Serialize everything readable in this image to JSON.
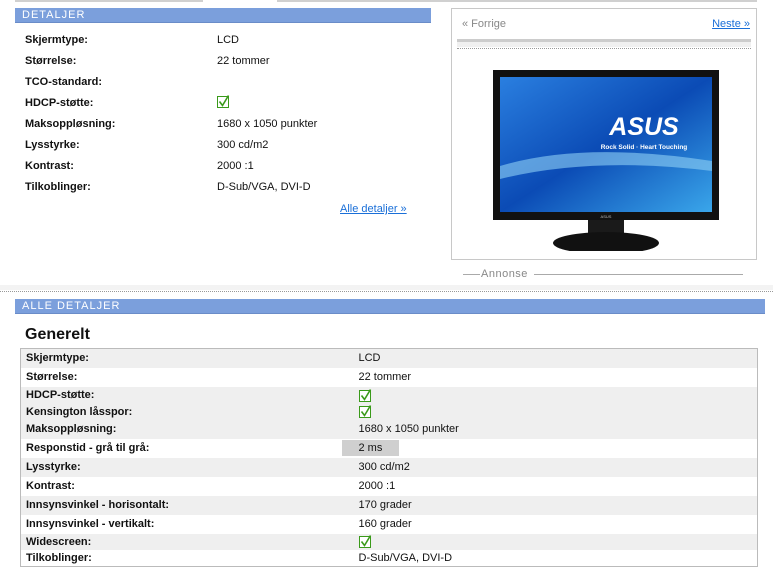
{
  "detaljer": {
    "title": "DETALJER",
    "rows": [
      {
        "label": "Skjermtype:",
        "value": "LCD"
      },
      {
        "label": "Størrelse:",
        "value": "22 tommer"
      },
      {
        "label": "TCO-standard:",
        "value": ""
      },
      {
        "label": "HDCP-støtte:",
        "checked": true
      },
      {
        "label": "Maksoppløsning:",
        "value": "1680 x 1050 punkter"
      },
      {
        "label": "Lysstyrke:",
        "value": "300 cd/m2"
      },
      {
        "label": "Kontrast:",
        "value": "2000 :1"
      },
      {
        "label": "Tilkoblinger:",
        "value": "D-Sub/VGA, DVI-D"
      }
    ],
    "all_link": "Alle detaljer »"
  },
  "gallery": {
    "prev": "« Forrige",
    "next": "Neste »",
    "logo": "ASUS",
    "tagline": "Rock Solid · Heart Touching",
    "bezel_logo": "ASUS"
  },
  "ad_label": "Annonse",
  "alle": {
    "title": "ALLE DETALJER",
    "section": "Generelt",
    "rows": [
      {
        "label": "Skjermtype:",
        "value": "LCD"
      },
      {
        "label": "Størrelse:",
        "value": "22 tommer"
      },
      {
        "label": "HDCP-støtte:",
        "checked": true
      },
      {
        "label": "Kensington låsspor:",
        "checked": true
      },
      {
        "label": "Maksoppløsning:",
        "value": "1680 x 1050 punkter"
      },
      {
        "label": "Responstid - grå til grå:",
        "value": "2 ms"
      },
      {
        "label": "Lysstyrke:",
        "value": "300 cd/m2"
      },
      {
        "label": "Kontrast:",
        "value": "2000 :1"
      },
      {
        "label": "Innsynsvinkel - horisontalt:",
        "value": "170 grader"
      },
      {
        "label": "Innsynsvinkel - vertikalt:",
        "value": "160 grader"
      },
      {
        "label": "Widescreen:",
        "checked": true
      },
      {
        "label": "Tilkoblinger:",
        "value": "D-Sub/VGA, DVI-D"
      }
    ]
  },
  "colors": {
    "header": "#7b9fdc",
    "link": "#1a6fd8",
    "check": "#3a9a1a"
  }
}
